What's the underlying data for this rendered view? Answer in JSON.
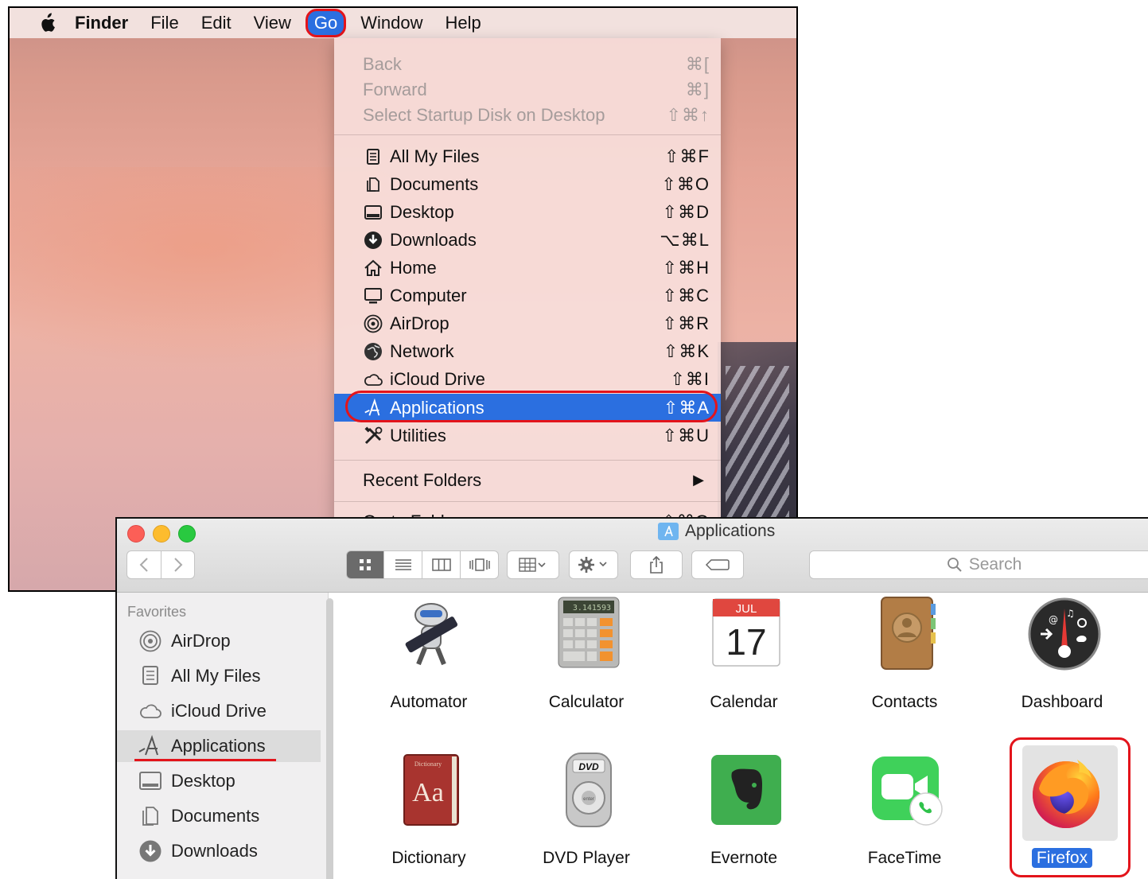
{
  "menubar": {
    "app_name": "Finder",
    "items": [
      "File",
      "Edit",
      "View",
      "Go",
      "Window",
      "Help"
    ]
  },
  "go_menu": {
    "disabled_items": [
      {
        "label": "Back",
        "shortcut": "⌘["
      },
      {
        "label": "Forward",
        "shortcut": "⌘]"
      },
      {
        "label": "Select Startup Disk on Desktop",
        "shortcut": "⇧⌘↑"
      }
    ],
    "items": [
      {
        "label": "All My Files",
        "shortcut": "⇧⌘F",
        "icon": "all-my-files-icon"
      },
      {
        "label": "Documents",
        "shortcut": "⇧⌘O",
        "icon": "documents-icon"
      },
      {
        "label": "Desktop",
        "shortcut": "⇧⌘D",
        "icon": "desktop-icon"
      },
      {
        "label": "Downloads",
        "shortcut": "⌥⌘L",
        "icon": "downloads-icon"
      },
      {
        "label": "Home",
        "shortcut": "⇧⌘H",
        "icon": "home-icon"
      },
      {
        "label": "Computer",
        "shortcut": "⇧⌘C",
        "icon": "computer-icon"
      },
      {
        "label": "AirDrop",
        "shortcut": "⇧⌘R",
        "icon": "airdrop-icon"
      },
      {
        "label": "Network",
        "shortcut": "⇧⌘K",
        "icon": "network-icon"
      },
      {
        "label": "iCloud Drive",
        "shortcut": "⇧⌘I",
        "icon": "icloud-icon"
      },
      {
        "label": "Applications",
        "shortcut": "⇧⌘A",
        "icon": "applications-icon",
        "selected": true
      },
      {
        "label": "Utilities",
        "shortcut": "⇧⌘U",
        "icon": "utilities-icon"
      }
    ],
    "recent_folders": "Recent Folders",
    "submenu_arrow": "▶",
    "go_to_folder": {
      "label": "Go to Folder...",
      "shortcut": "⇧⌘G"
    }
  },
  "finder": {
    "title": "Applications",
    "search_placeholder": "Search",
    "sidebar": {
      "heading": "Favorites",
      "items": [
        "AirDrop",
        "All My Files",
        "iCloud Drive",
        "Applications",
        "Desktop",
        "Documents",
        "Downloads"
      ],
      "selected": "Applications"
    },
    "apps": [
      "Automator",
      "Calculator",
      "Calendar",
      "Contacts",
      "Dashboard",
      "Dictionary",
      "DVD Player",
      "Evernote",
      "FaceTime",
      "Firefox"
    ],
    "calendar_icon": {
      "month": "JUL",
      "day": "17"
    },
    "calculator_display": "3.141593",
    "dictionary_icon": {
      "title": "Dictionary",
      "glyph": "Aa"
    },
    "dvd_icon": {
      "label": "DVD",
      "button": "enter"
    },
    "selected_app": "Firefox"
  },
  "colors": {
    "highlight": "#2b6fe0",
    "annotation_red": "#e3141b"
  }
}
